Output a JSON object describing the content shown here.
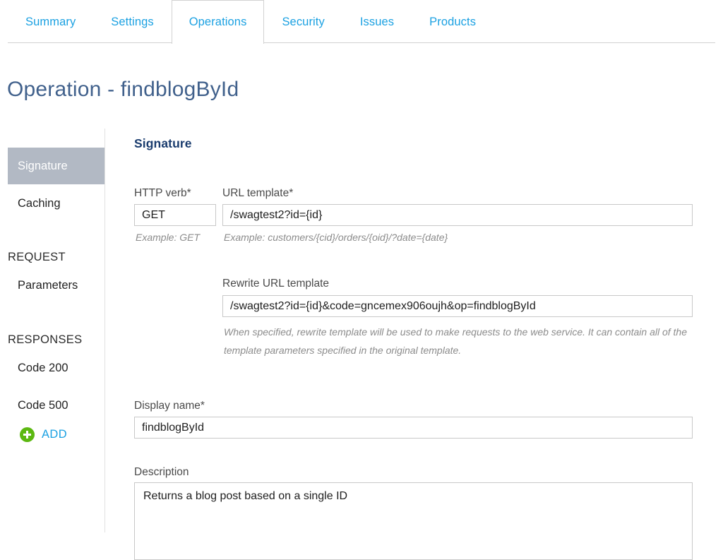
{
  "tabs": [
    {
      "label": "Summary",
      "active": false
    },
    {
      "label": "Settings",
      "active": false
    },
    {
      "label": "Operations",
      "active": true
    },
    {
      "label": "Security",
      "active": false
    },
    {
      "label": "Issues",
      "active": false
    },
    {
      "label": "Products",
      "active": false
    }
  ],
  "page": {
    "title": "Operation - findblogById"
  },
  "sidebar": {
    "items": [
      {
        "label": "Signature",
        "selected": true
      },
      {
        "label": "Caching",
        "selected": false
      }
    ],
    "groups": [
      {
        "heading": "REQUEST",
        "items": [
          {
            "label": "Parameters",
            "selected": false
          }
        ]
      },
      {
        "heading": "RESPONSES",
        "items": [
          {
            "label": "Code 200",
            "selected": false
          },
          {
            "label": "Code 500",
            "selected": false
          }
        ]
      }
    ],
    "add_button": {
      "label": "ADD",
      "icon": "plus-circle-icon"
    }
  },
  "form": {
    "heading": "Signature",
    "http_verb": {
      "label": "HTTP verb*",
      "value": "GET",
      "placeholder": "",
      "hint": "Example: GET"
    },
    "url_template": {
      "label": "URL template*",
      "value": "/swagtest2?id={id}",
      "placeholder": "",
      "hint": "Example: customers/{cid}/orders/{oid}/?date={date}"
    },
    "rewrite_url_template": {
      "label": "Rewrite URL template",
      "value": "/swagtest2?id={id}&code=gncemex906oujh&op=findblogById",
      "placeholder": "",
      "hint": "When specified, rewrite template will be used to make requests to the web service. It can contain all of the template parameters specified in the original template."
    },
    "display_name": {
      "label": "Display name*",
      "value": "findblogById",
      "placeholder": ""
    },
    "description": {
      "label": "Description",
      "value": "Returns a blog post based on a single ID",
      "placeholder": ""
    }
  },
  "colors": {
    "tab_link": "#1ba1e2",
    "title": "#41618c",
    "heading": "#1a3c6e",
    "selected_nav_bg": "#b2b9c4",
    "add_icon": "#5cb811",
    "border": "#c8c8c8"
  }
}
